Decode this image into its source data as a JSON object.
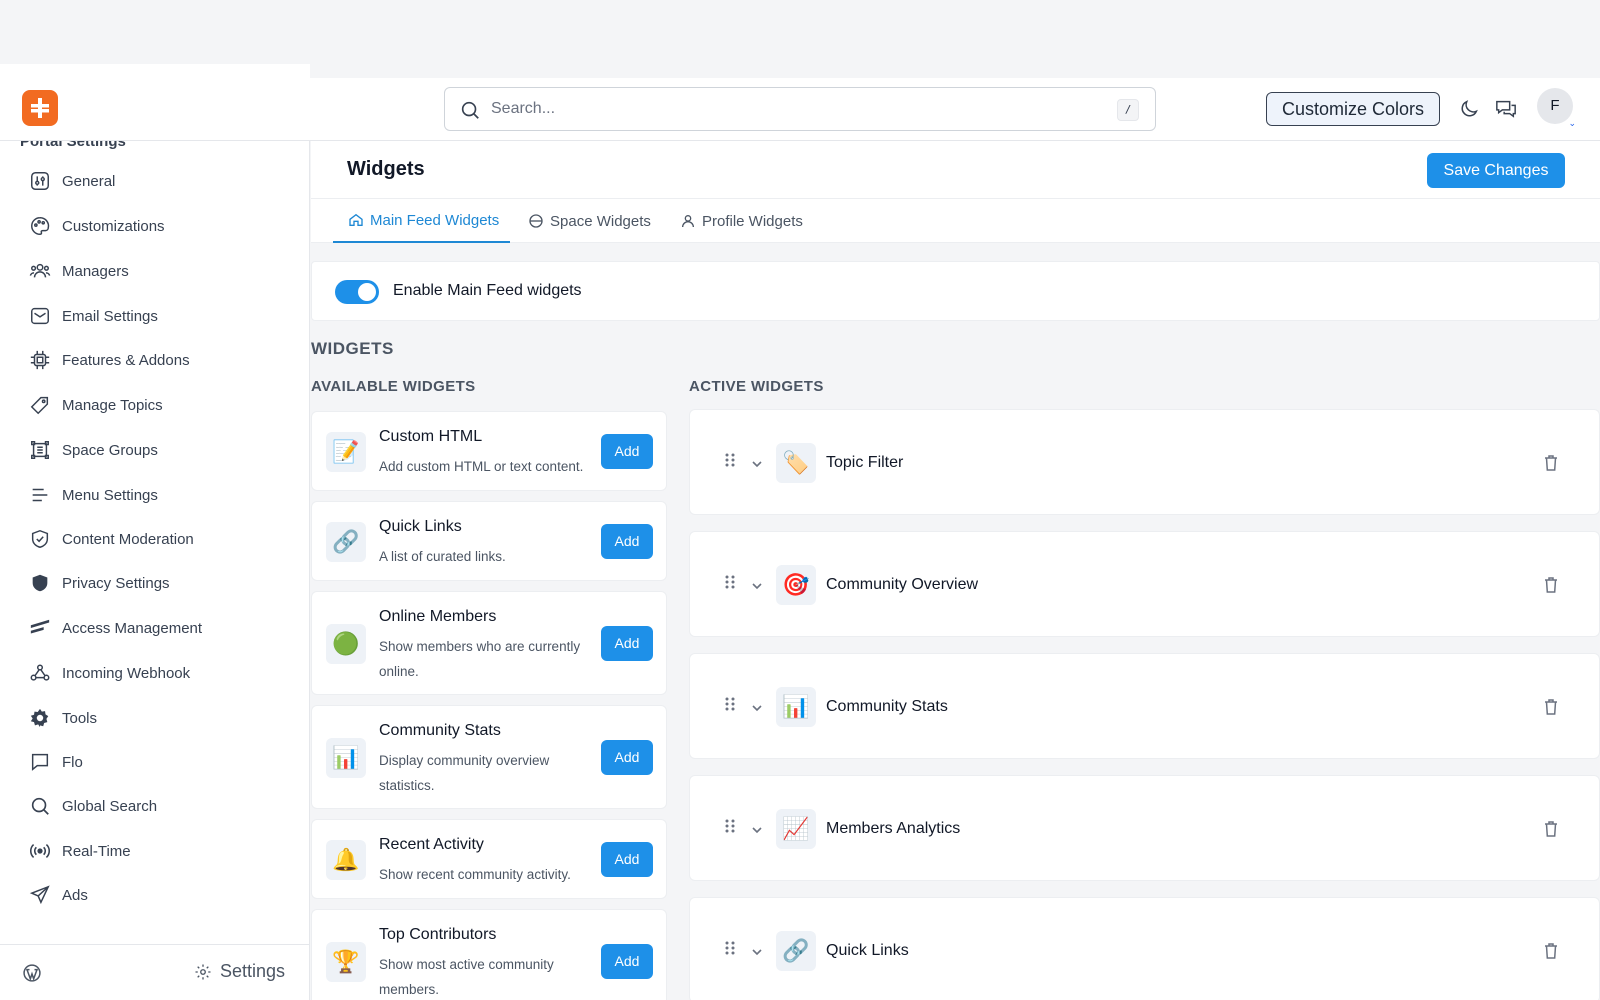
{
  "header": {
    "search_placeholder": "Search...",
    "search_shortcut": "/",
    "customize_label": "Customize Colors",
    "avatar_initial": "F"
  },
  "sidebar": {
    "section_title": "Portal Settings",
    "items": [
      {
        "label": "General",
        "icon": "sliders-icon"
      },
      {
        "label": "Customizations",
        "icon": "palette-icon"
      },
      {
        "label": "Managers",
        "icon": "users-icon"
      },
      {
        "label": "Email Settings",
        "icon": "mail-icon"
      },
      {
        "label": "Features & Addons",
        "icon": "chip-icon"
      },
      {
        "label": "Manage Topics",
        "icon": "tag-icon"
      },
      {
        "label": "Space Groups",
        "icon": "grid-icon"
      },
      {
        "label": "Menu Settings",
        "icon": "menu-icon"
      },
      {
        "label": "Content Moderation",
        "icon": "shield-check-icon"
      },
      {
        "label": "Privacy Settings",
        "icon": "shield-icon"
      },
      {
        "label": "Access Management",
        "icon": "access-icon"
      },
      {
        "label": "Incoming Webhook",
        "icon": "webhook-icon"
      },
      {
        "label": "Tools",
        "icon": "gear-icon"
      },
      {
        "label": "Flo",
        "icon": "chat-icon"
      },
      {
        "label": "Global Search",
        "icon": "search-icon"
      },
      {
        "label": "Real-Time",
        "icon": "broadcast-icon"
      },
      {
        "label": "Ads",
        "icon": "send-icon"
      }
    ],
    "footer_settings_label": "Settings"
  },
  "main": {
    "title": "Widgets",
    "save_label": "Save Changes",
    "tabs": [
      {
        "label": "Main Feed Widgets",
        "active": true
      },
      {
        "label": "Space Widgets",
        "active": false
      },
      {
        "label": "Profile Widgets",
        "active": false
      }
    ],
    "enable_label": "Enable Main Feed widgets",
    "enable_on": true,
    "section_title": "WIDGETS",
    "available_title": "AVAILABLE WIDGETS",
    "active_title": "ACTIVE WIDGETS",
    "available": [
      {
        "title": "Custom HTML",
        "desc": "Add custom HTML or text content.",
        "emoji": "📝",
        "add": "Add"
      },
      {
        "title": "Quick Links",
        "desc": "A list of curated links.",
        "emoji": "🔗",
        "add": "Add"
      },
      {
        "title": "Online Members",
        "desc": "Show members who are currently online.",
        "emoji": "🟢",
        "add": "Add"
      },
      {
        "title": "Community Stats",
        "desc": "Display community overview statistics.",
        "emoji": "📊",
        "add": "Add"
      },
      {
        "title": "Recent Activity",
        "desc": "Show recent community activity.",
        "emoji": "🔔",
        "add": "Add"
      },
      {
        "title": "Top Contributors",
        "desc": "Show most active community members.",
        "emoji": "🏆",
        "add": "Add"
      }
    ],
    "active": [
      {
        "title": "Topic Filter",
        "emoji": "🏷️"
      },
      {
        "title": "Community Overview",
        "emoji": "🎯"
      },
      {
        "title": "Community Stats",
        "emoji": "📊"
      },
      {
        "title": "Members Analytics",
        "emoji": "📈"
      },
      {
        "title": "Quick Links",
        "emoji": "🔗"
      }
    ]
  },
  "colors": {
    "accent": "#1e90e8",
    "logo": "#f26b21"
  }
}
